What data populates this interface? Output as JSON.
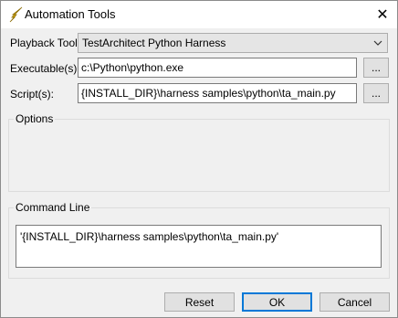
{
  "window": {
    "title": "Automation Tools",
    "close_glyph": "✕"
  },
  "fields": {
    "playback_tool": {
      "label": "Playback Tool:",
      "value": "TestArchitect Python Harness"
    },
    "executable": {
      "label": "Executable(s):",
      "value": "c:\\Python\\python.exe"
    },
    "script": {
      "label": "Script(s):",
      "value": "{INSTALL_DIR}\\harness samples\\python\\ta_main.py"
    },
    "browse_label": "..."
  },
  "groups": {
    "options": {
      "title": "Options"
    },
    "command_line": {
      "title": "Command Line",
      "value": "'{INSTALL_DIR}\\harness samples\\python\\ta_main.py'"
    }
  },
  "buttons": {
    "reset": "Reset",
    "ok": "OK",
    "cancel": "Cancel"
  },
  "icons": {
    "app": "lightning-icon",
    "dropdown": "chevron-down-icon",
    "close": "close-icon"
  },
  "colors": {
    "window_bg": "#f0f0f0",
    "titlebar_bg": "#ffffff",
    "default_button_border": "#0078d7",
    "app_icon": "#f2c200"
  }
}
